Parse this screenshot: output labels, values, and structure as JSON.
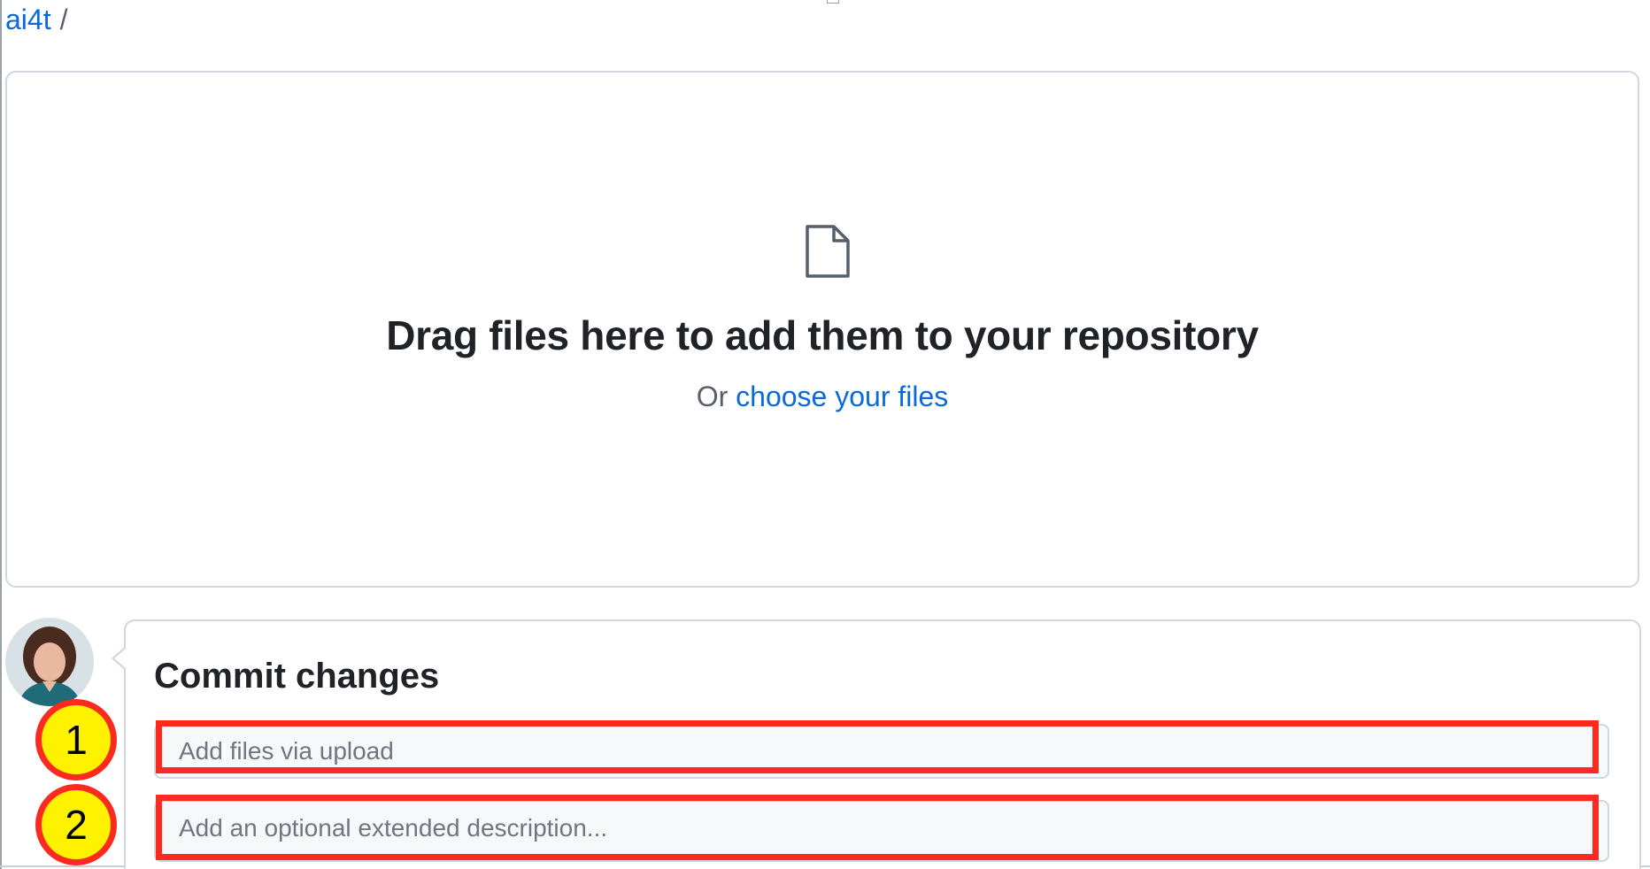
{
  "breadcrumb": {
    "owner": "ai4t",
    "separator": "/"
  },
  "dropzone": {
    "icon": "file-icon",
    "title": "Drag files here to add them to your repository",
    "subtitle_prefix": "Or",
    "choose_link": "choose your files"
  },
  "commit": {
    "title": "Commit changes",
    "summary_placeholder": "Add files via upload",
    "description_placeholder": "Add an optional extended description..."
  },
  "annotations": {
    "callout_1": "1",
    "callout_2": "2"
  },
  "colors": {
    "link": "#0969da",
    "highlight": "#ff2a1f",
    "callout_fill": "#fff200"
  }
}
